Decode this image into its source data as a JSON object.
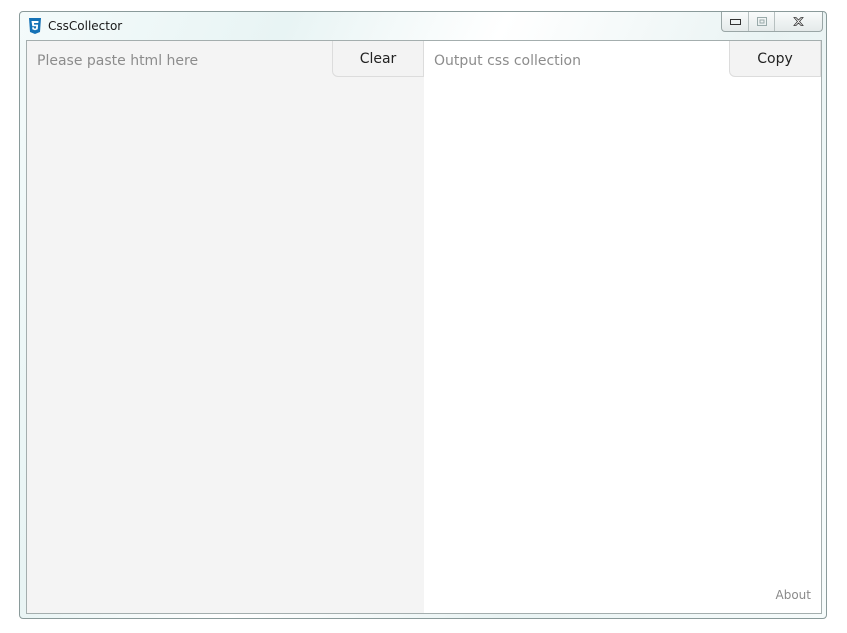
{
  "window": {
    "title": "CssCollector",
    "icon": "css3-shield-icon",
    "accent_color": "#1572b6"
  },
  "caption": {
    "minimize_icon": "minimize-icon",
    "maximize_icon": "maximize-icon",
    "close_icon": "close-icon"
  },
  "input_pane": {
    "value": "",
    "placeholder": "Please paste html here",
    "clear_label": "Clear"
  },
  "output_pane": {
    "value": "",
    "placeholder": "Output css collection",
    "copy_label": "Copy"
  },
  "footer": {
    "about_label": "About"
  }
}
